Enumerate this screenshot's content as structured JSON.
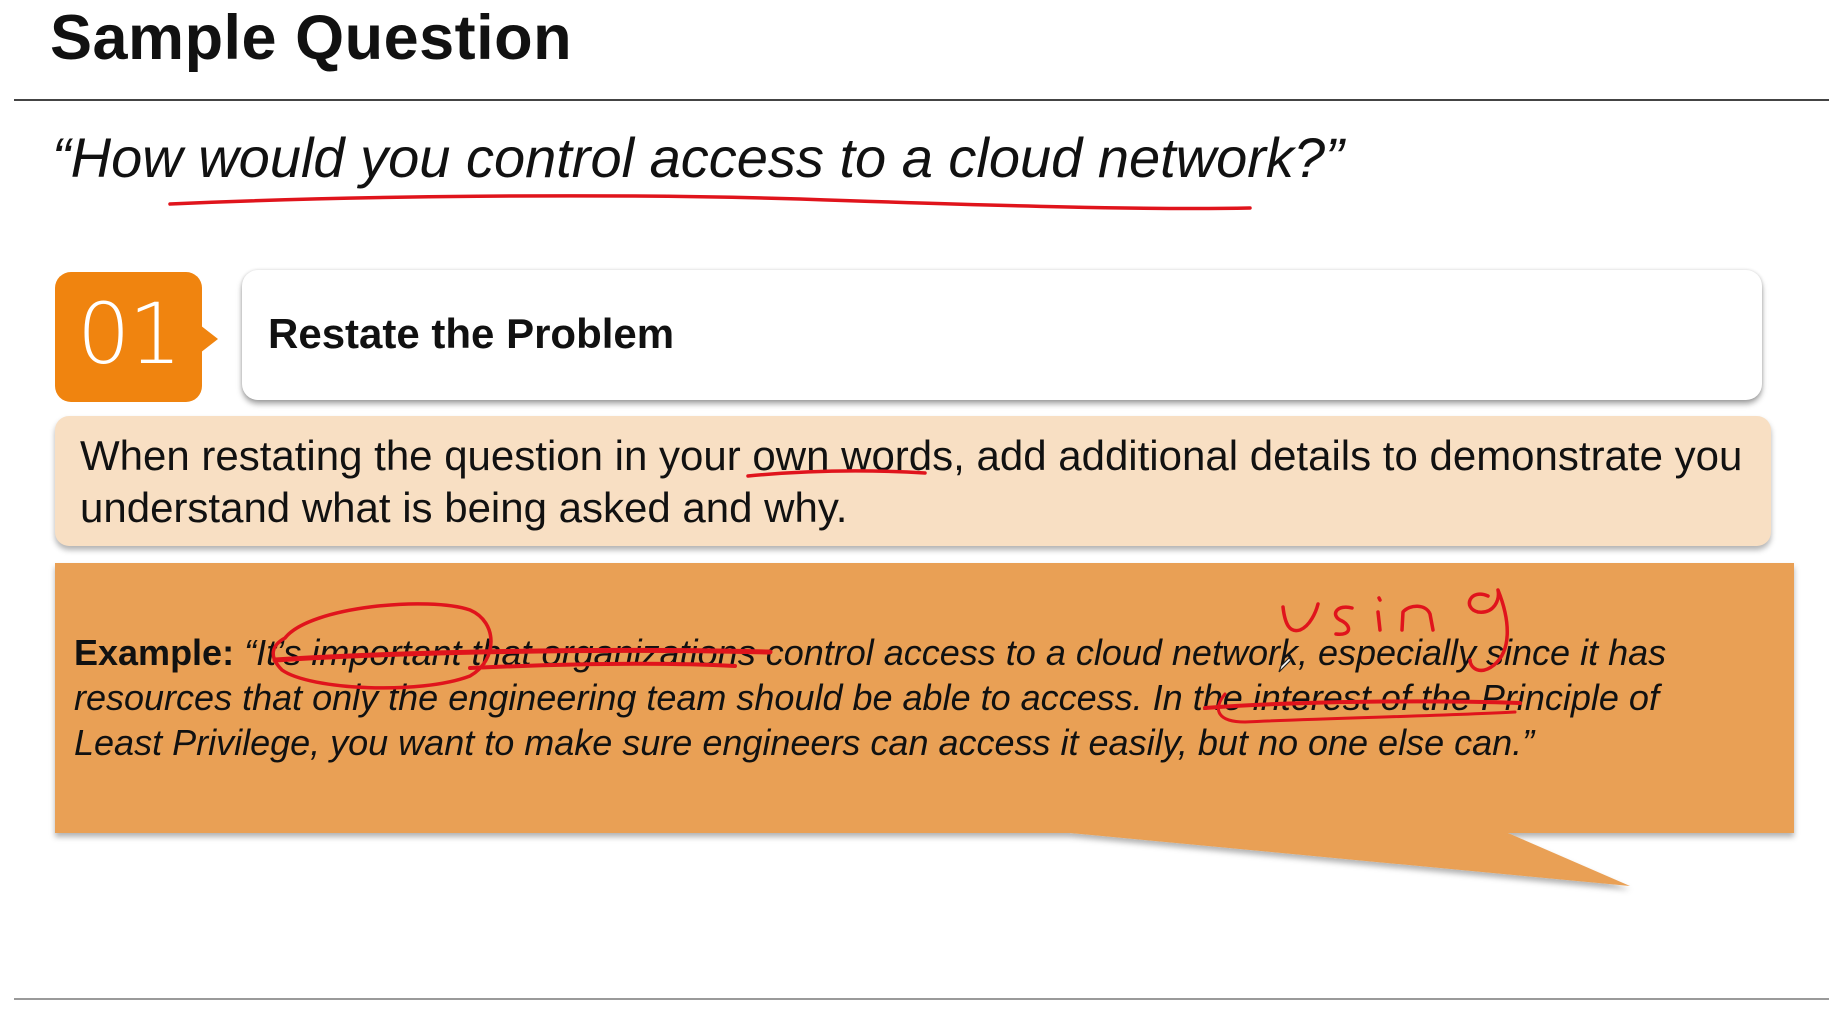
{
  "slide": {
    "title": "Sample Question",
    "question": "“How would you control access to a cloud network?”"
  },
  "step": {
    "number": "01",
    "title": "Restate the Problem"
  },
  "tip": {
    "text": "When restating the question in your own words, add additional details to demonstrate you understand what is being asked and why."
  },
  "example": {
    "label": "Example:",
    "quote": "“It’s important that organizations control access to a cloud network, especially since it has resources that only the engineering team should be able to access. In the interest of the Principle of Least Privilege, you want to make sure engineers can access it easily, but no one else can.”"
  },
  "annotations": {
    "handwritten_word": "Using",
    "ink_color": "#e0141c"
  },
  "colors": {
    "badge": "#f0840f",
    "tip_background": "#f8dfc3",
    "example_background": "#e9a055"
  },
  "icons": {
    "cursor": "pen-cursor-icon"
  }
}
